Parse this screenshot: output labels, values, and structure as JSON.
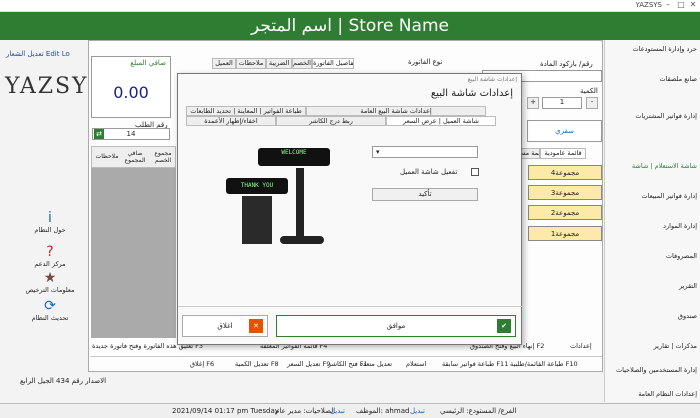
{
  "window": {
    "title": "YAZSYS",
    "min": "–",
    "max": "□",
    "close": "✕"
  },
  "header": {
    "title": "اسم المتجر | Store Name"
  },
  "left": {
    "edit_logo": "تعديل الشعار Edit Lo",
    "logo": "YAZSYS",
    "menu": [
      {
        "label": "حول النظام",
        "icon": "i"
      },
      {
        "label": "مركز الدعم",
        "icon": "?"
      },
      {
        "label": "معلومات الترخيص",
        "icon": "★"
      },
      {
        "label": "تحديث النظام",
        "icon": "⟳"
      }
    ],
    "version": "الاصدار رقم 434 الجيل الرابع"
  },
  "main": {
    "net_amount_label": "صافي المبلغ",
    "net_amount": "0.00",
    "order_no_label": "رقم الطلب",
    "order_no": "14",
    "invoice_type_label": "نوع الفاتورة",
    "barcode_label": "رقم/ باركود المادة",
    "qty_label": "الكمية",
    "qty_value": "1",
    "top_tabs": [
      "تفاصيل الفاتورة",
      "الخصم",
      "الضريبة",
      "ملاحظات",
      "العميل"
    ],
    "grid_headers": [
      "مجموع الخصم",
      "صافي المجموع",
      "ملاحظات"
    ],
    "right_tabs": [
      "قائمة عامودية",
      "قائمة مسدلة"
    ],
    "groups": [
      "مجموعة4",
      "مجموعة3",
      "مجموعة2",
      "مجموعة1"
    ],
    "safari": "سفري"
  },
  "sidebar": {
    "items": [
      "حرد وإدارة المستودعات",
      "صانع ملصقات",
      "إدارة فواتير المشتريات",
      "شاشة الاستعلام | شاشة",
      "إدارة فواتير المبيعات",
      "إدارة الموارد",
      "المصروفات",
      "التقرير",
      "صندوق",
      "مذكرات | تقارير",
      "إدارة المستخدمين والصلاحيات",
      "إعدادات النظام العامة"
    ]
  },
  "toolbar": {
    "items": [
      "إغلاق F6",
      "تعديل الكمية F8",
      "تعديل السعر F9",
      "فتح الكاشر F1",
      "تعديل متعدد",
      "استعلام",
      "طباعة فواتير سابقة F11",
      "طباعة القائمة/طلبية F10"
    ],
    "row2": [
      "تعليق هذه الفاتورة وفتح فاتورة جديدة F3",
      "قائمة الفواتير المعلقة F4",
      "إنهاء البيع وفتح الصندوق F2",
      "إعدادات"
    ]
  },
  "dialog": {
    "window_title": "إعدادات شاشة البيع",
    "heading": "إعدادات شاشة البيع",
    "tabs_row1": [
      "إعدادات شاشة البيع العامة",
      "طباعة الفواتير | المعاينة | تحديد الطابعات"
    ],
    "tabs_row2": [
      "شاشة العميل | عرض السعر",
      "ربط درج الكاشر",
      "اخفاء/إظهار الأعمدة"
    ],
    "checkbox_label": "تفعيل شاشة العميل",
    "confirm": "تأكيد",
    "ok": "موافق",
    "close": "اغلاق",
    "display_top": "WELCOME",
    "display_bottom": "THANK YOU"
  },
  "status": {
    "branch": "الفرع/ المستودع: الرئيسي",
    "edit1": "تبديل",
    "employee": "الموظف: ahmad",
    "edit2": "تبديل",
    "perms": "الصلاحيات: مدير عام",
    "datetime": "2021/09/14 01:17 pm Tuesday"
  },
  "colors": {
    "green": "#2e7d32",
    "amount_blue": "#1a237e",
    "group_bg": "#fde9a8"
  }
}
